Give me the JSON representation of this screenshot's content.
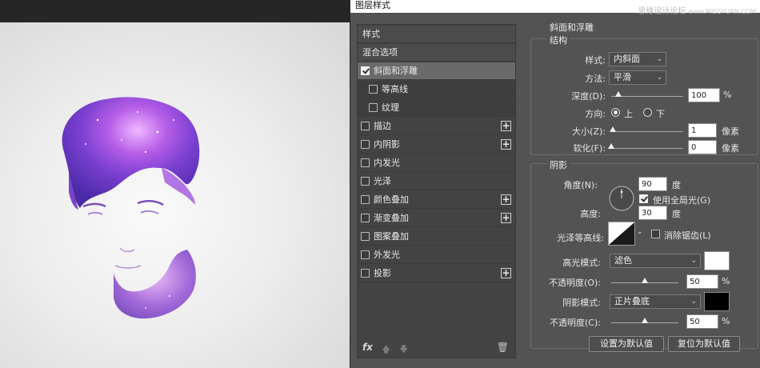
{
  "dialog": {
    "title": "图层样式",
    "watermark": "思缘设计论坛",
    "watermark_suffix": "www.MISSYUAN.COM"
  },
  "styles_list": {
    "items": [
      {
        "label": "样式",
        "checked": false,
        "has_checkbox": false,
        "has_plus": false,
        "type": "header"
      },
      {
        "label": "混合选项",
        "checked": false,
        "has_checkbox": false,
        "has_plus": false,
        "type": "header"
      },
      {
        "label": "斜面和浮雕",
        "checked": true,
        "has_checkbox": true,
        "has_plus": false,
        "type": "selected"
      },
      {
        "label": "等高线",
        "checked": false,
        "has_checkbox": true,
        "has_plus": false,
        "type": "sub"
      },
      {
        "label": "纹理",
        "checked": false,
        "has_checkbox": true,
        "has_plus": false,
        "type": "sub"
      },
      {
        "label": "描边",
        "checked": false,
        "has_checkbox": true,
        "has_plus": true,
        "type": "normal"
      },
      {
        "label": "内阴影",
        "checked": false,
        "has_checkbox": true,
        "has_plus": true,
        "type": "normal"
      },
      {
        "label": "内发光",
        "checked": false,
        "has_checkbox": true,
        "has_plus": false,
        "type": "normal"
      },
      {
        "label": "光泽",
        "checked": false,
        "has_checkbox": true,
        "has_plus": false,
        "type": "normal"
      },
      {
        "label": "颜色叠加",
        "checked": false,
        "has_checkbox": true,
        "has_plus": true,
        "type": "normal"
      },
      {
        "label": "渐变叠加",
        "checked": false,
        "has_checkbox": true,
        "has_plus": true,
        "type": "normal"
      },
      {
        "label": "图案叠加",
        "checked": false,
        "has_checkbox": true,
        "has_plus": false,
        "type": "normal"
      },
      {
        "label": "外发光",
        "checked": false,
        "has_checkbox": true,
        "has_plus": false,
        "type": "normal"
      },
      {
        "label": "投影",
        "checked": false,
        "has_checkbox": true,
        "has_plus": true,
        "type": "normal"
      }
    ],
    "footer": {
      "fx": "fx",
      "up_icon": "arrow-up-icon",
      "down_icon": "arrow-down-icon",
      "delete_icon": "trash-icon"
    }
  },
  "bevel": {
    "section_title": "斜面和浮雕",
    "structure": {
      "legend": "结构",
      "style_label": "样式:",
      "style_value": "内斜面",
      "technique_label": "方法:",
      "technique_value": "平滑",
      "depth_label": "深度(D):",
      "depth_value": "100",
      "depth_unit": "%",
      "depth_slider": 0.1,
      "direction_label": "方向:",
      "direction_up": "上",
      "direction_down": "下",
      "direction_selected": "up",
      "size_label": "大小(Z):",
      "size_value": "1",
      "size_unit": "像素",
      "size_slider": 0.02,
      "soften_label": "软化(F):",
      "soften_value": "0",
      "soften_unit": "像素",
      "soften_slider": 0.0
    },
    "shading": {
      "legend": "阴影",
      "angle_label": "角度(N):",
      "angle_value": "90",
      "angle_unit": "度",
      "global_light_label": "使用全局光(G)",
      "global_light_checked": true,
      "altitude_label": "高度:",
      "altitude_value": "30",
      "altitude_unit": "度",
      "gloss_contour_label": "光泽等高线:",
      "anti_alias_label": "消除锯齿(L)",
      "anti_alias_checked": false,
      "highlight_mode_label": "高光模式:",
      "highlight_mode_value": "滤色",
      "highlight_color": "#ffffff",
      "highlight_opacity_label": "不透明度(O):",
      "highlight_opacity_value": "50",
      "highlight_opacity_unit": "%",
      "highlight_opacity_slider": 0.5,
      "shadow_mode_label": "阴影模式:",
      "shadow_mode_value": "正片叠底",
      "shadow_color": "#000000",
      "shadow_opacity_label": "不透明度(C):",
      "shadow_opacity_value": "50",
      "shadow_opacity_unit": "%",
      "shadow_opacity_slider": 0.5
    },
    "buttons": {
      "make_default": "设置为默认值",
      "reset_default": "复位为默认值"
    }
  }
}
